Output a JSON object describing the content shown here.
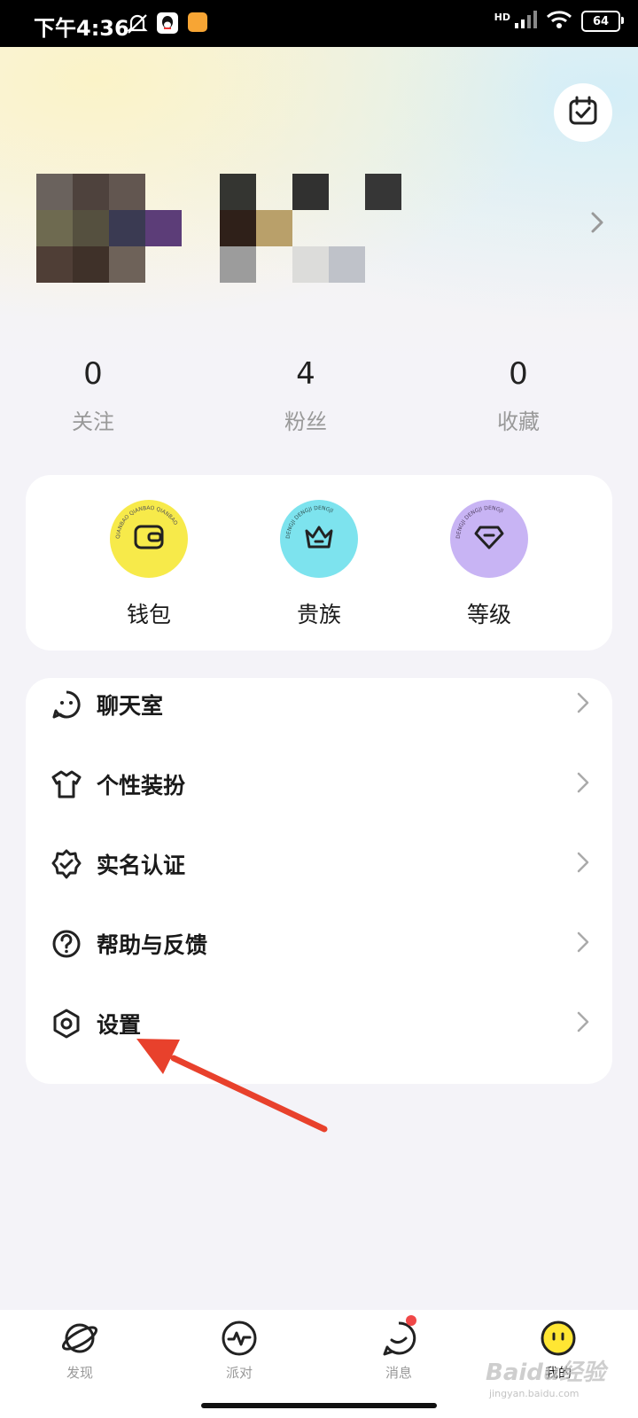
{
  "status_bar": {
    "time": "下午4:36",
    "network": "HD",
    "battery": "64"
  },
  "profile": {
    "checkin_icon": "calendar-check-icon"
  },
  "stats": [
    {
      "value": "0",
      "label": "关注"
    },
    {
      "value": "4",
      "label": "粉丝"
    },
    {
      "value": "0",
      "label": "收藏"
    }
  ],
  "features": [
    {
      "label": "钱包",
      "badge_text": "QIANBAO QIANBAO QIANBAO",
      "color": "#f7ea4a",
      "icon": "wallet-icon"
    },
    {
      "label": "贵族",
      "badge_text": "DENGJI DENGJI DENGJI",
      "color": "#7de3ee",
      "icon": "crown-icon"
    },
    {
      "label": "等级",
      "badge_text": "DENGJI DENGJI DENGJI",
      "color": "#c8b4f4",
      "icon": "gem-icon"
    }
  ],
  "menu": [
    {
      "label": "聊天室",
      "icon": "chat-room-icon"
    },
    {
      "label": "个性装扮",
      "icon": "tshirt-icon"
    },
    {
      "label": "实名认证",
      "icon": "verified-badge-icon"
    },
    {
      "label": "帮助与反馈",
      "icon": "help-icon"
    },
    {
      "label": "设置",
      "icon": "settings-icon"
    }
  ],
  "nav": [
    {
      "label": "发现",
      "icon": "planet-icon"
    },
    {
      "label": "派对",
      "icon": "party-pulse-icon"
    },
    {
      "label": "消息",
      "icon": "message-icon"
    },
    {
      "label": "我的",
      "icon": "smiley-icon"
    }
  ],
  "watermark": {
    "text": "Baidu经验",
    "sub": "jingyan.baidu.com"
  },
  "colors": {
    "accent_yellow": "#ffe633",
    "arrow_red": "#e8412c",
    "badge_red": "#f04848"
  }
}
